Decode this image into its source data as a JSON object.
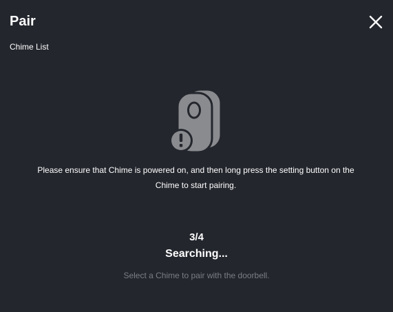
{
  "dialog": {
    "title": "Pair",
    "breadcrumb": "Chime List",
    "close_icon": "close-icon"
  },
  "illustration": {
    "icon": "chime-warning-icon",
    "device_color": "#8a8b8f",
    "badge_color": "#8a8b8f"
  },
  "instructions": {
    "text": "Please ensure that Chime is powered on, and then long press the setting button on the Chime to start pairing."
  },
  "progress": {
    "step": "3/4",
    "status": "Searching...",
    "hint": "Select a Chime to pair with the doorbell."
  },
  "colors": {
    "background": "#23262d",
    "text_primary": "#ffffff",
    "text_muted": "#7b7e85"
  }
}
